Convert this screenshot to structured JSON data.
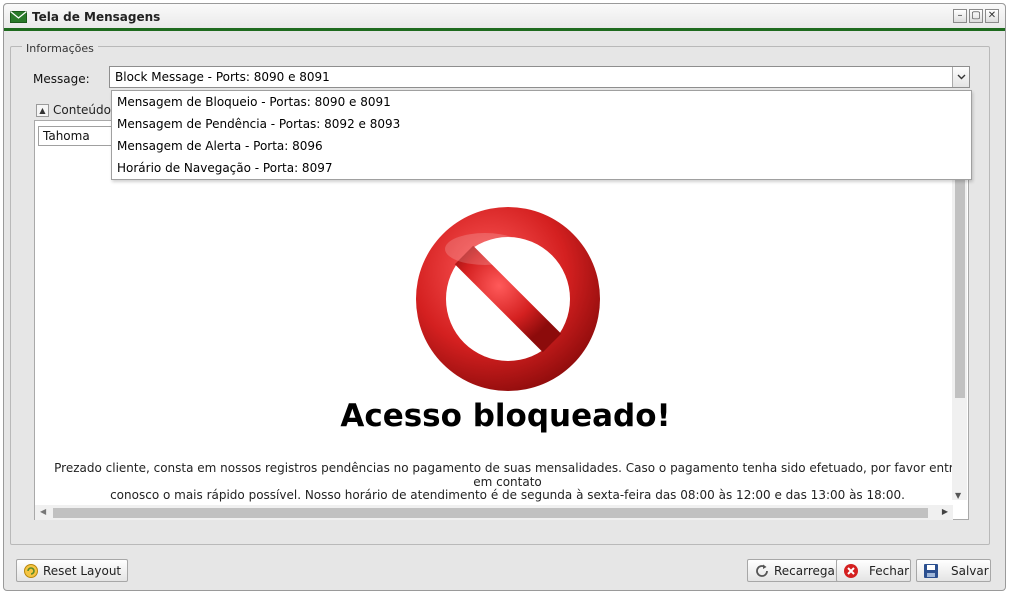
{
  "window": {
    "title": "Tela de Mensagens"
  },
  "info": {
    "legend": "Informações",
    "message_label": "Message:",
    "selected_message": "Block Message - Ports: 8090 e 8091",
    "options": [
      "Mensagem de Bloqueio - Portas: 8090 e 8091",
      "Mensagem de Pendência - Portas: 8092 e 8093",
      "Mensagem de Alerta - Porta: 8096",
      "Horário de Navegação - Porta: 8097"
    ]
  },
  "content": {
    "title": "Conteúdo",
    "font": "Tahoma",
    "heading": "Acesso bloqueado!",
    "paragraph_line1": "Prezado cliente, consta em nossos registros pendências no pagamento de suas mensalidades. Caso o pagamento tenha sido efetuado, por favor entre em contato",
    "paragraph_line2": "conosco o mais rápido possível. Nosso horário de atendimento é de segunda à sexta-feira das 08:00 às 12:00 e das 13:00 às 18:00."
  },
  "buttons": {
    "reset_layout": "Reset Layout",
    "reload": "Recarregar",
    "close": "Fechar",
    "save": "Salvar"
  },
  "colors": {
    "accent": "#1e6a1e",
    "stop_red": "#d42020"
  }
}
